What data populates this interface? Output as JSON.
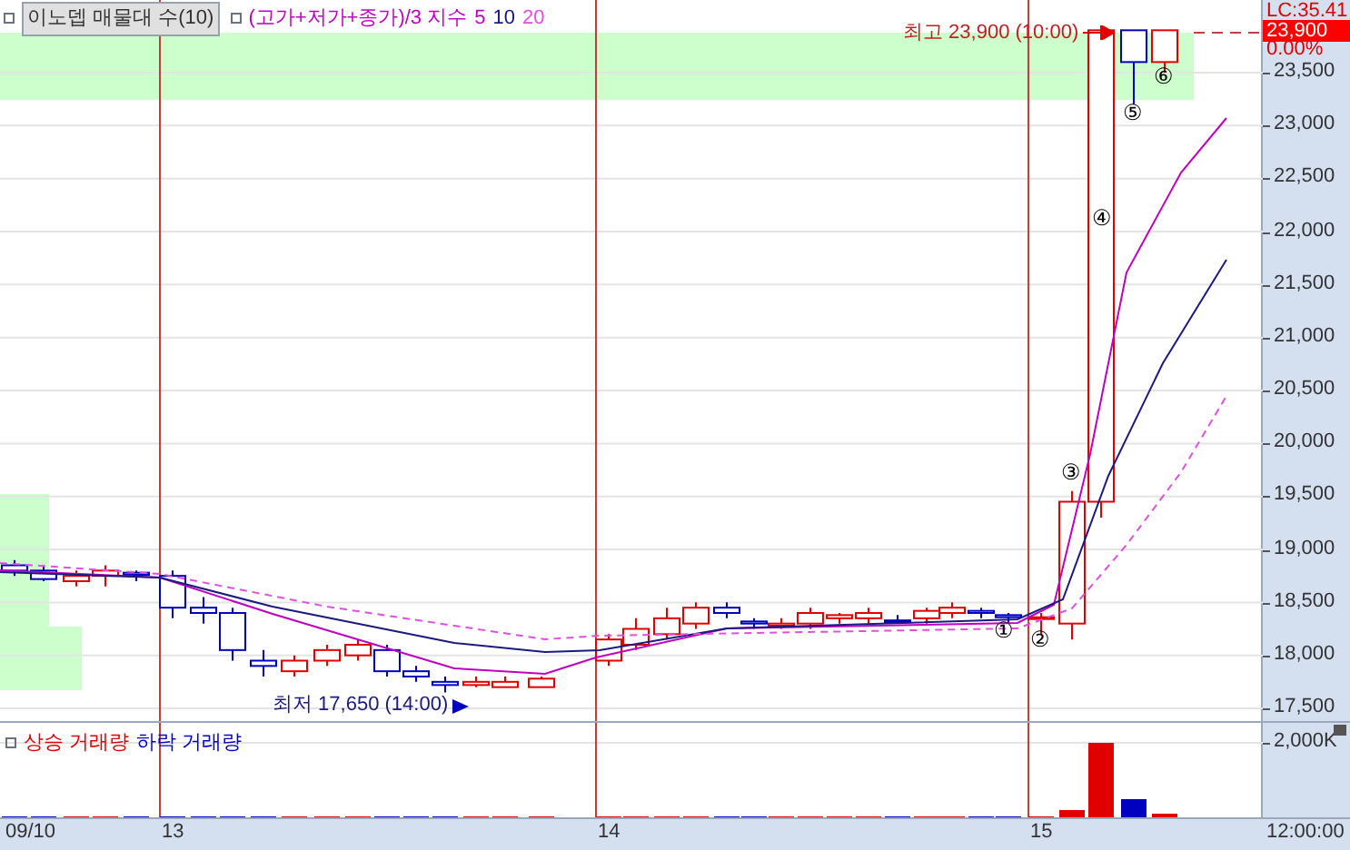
{
  "price_panel": {
    "legend": {
      "indicator": "이노뎁 매물대 수(10)",
      "formula": "(고가+저가+종가)/3 지수",
      "periods": [
        {
          "label": "5",
          "color": "#c000c0"
        },
        {
          "label": "10",
          "color": "#1a1a80"
        },
        {
          "label": "20",
          "color": "#e050e0"
        }
      ]
    },
    "high_note": "최고 23,900 (10:00)",
    "low_note": "최저 17,650 (14:00)",
    "markers": [
      "①",
      "②",
      "③",
      "④",
      "⑤",
      "⑥"
    ],
    "axis": {
      "lc": "LC:35.41",
      "current": "23,900",
      "change": "0.00%",
      "ticks": [
        "23,500",
        "23,000",
        "22,500",
        "22,000",
        "21,500",
        "21,000",
        "20,500",
        "20,000",
        "19,500",
        "19,000",
        "18,500",
        "18,000",
        "17,500"
      ]
    }
  },
  "volume_panel": {
    "legend": [
      {
        "label": "상승 거래량",
        "color": "#e00000"
      },
      {
        "label": "하락 거래량",
        "color": "#0000c0"
      }
    ],
    "tick": "2,000K"
  },
  "x_axis": {
    "labels": [
      "09/10",
      "13",
      "14",
      "15"
    ],
    "time": "12:00:00"
  }
}
